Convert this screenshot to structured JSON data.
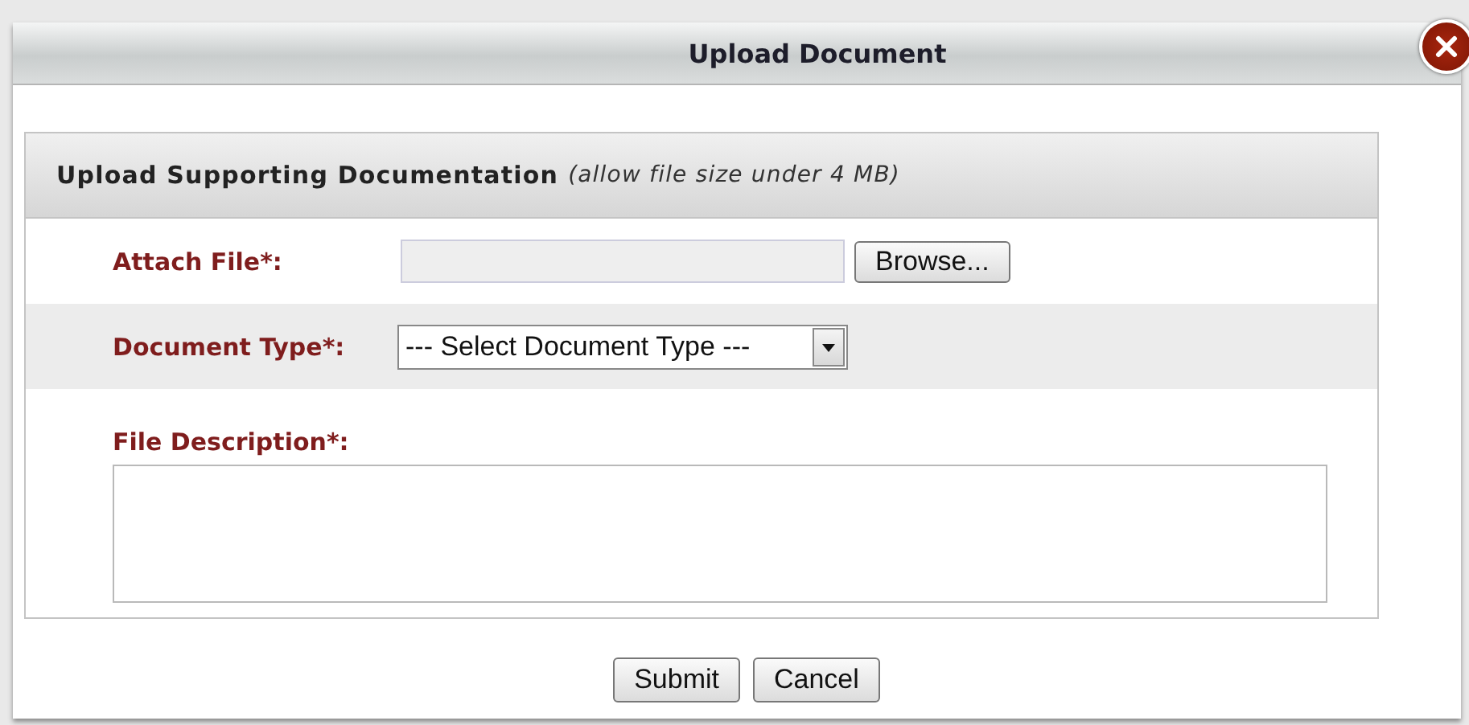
{
  "dialog": {
    "title": "Upload Document"
  },
  "section": {
    "title": "Upload Supporting Documentation",
    "note": "(allow file size under 4 MB)"
  },
  "fields": [
    {
      "kind": "file",
      "label": "Attach File*:",
      "button": "Browse..."
    },
    {
      "kind": "select",
      "label": "Document Type*:",
      "value": "--- Select Document Type ---"
    },
    {
      "kind": "textarea",
      "label": "File Description*:"
    }
  ],
  "buttons": [
    "Submit",
    "Cancel"
  ]
}
